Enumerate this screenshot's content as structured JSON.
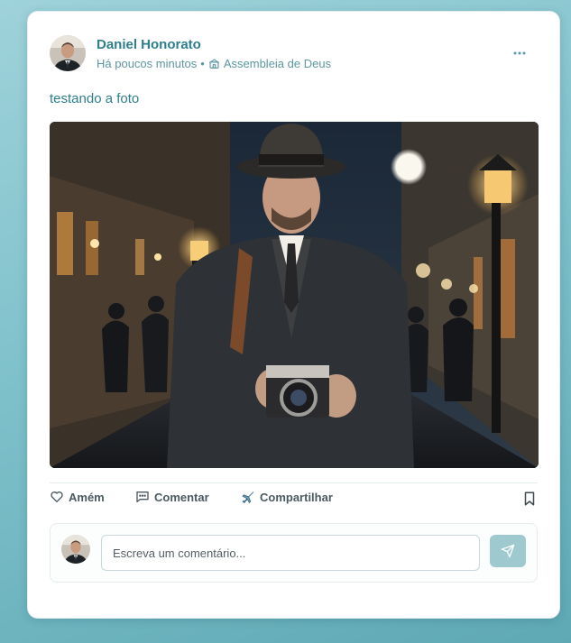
{
  "post": {
    "author": "Daniel Honorato",
    "time": "Há poucos minutos",
    "separator": "•",
    "church": "Assembleia de Deus",
    "text": "testando a foto",
    "photo_alt": "Homem de chapéu segurando uma câmera antiga em rua iluminada à noite"
  },
  "actions": {
    "like_label": "Amém",
    "comment_label": "Comentar",
    "share_label": "Compartilhar"
  },
  "comment": {
    "placeholder": "Escreva um comentário..."
  },
  "colors": {
    "brand": "#2d7f8c",
    "send_button": "#9ec9cf",
    "background": "#7fc1cb"
  },
  "icons": [
    "more-options-icon",
    "church-icon",
    "heart-icon",
    "comment-icon",
    "airplane-icon",
    "bookmark-icon",
    "send-icon"
  ]
}
